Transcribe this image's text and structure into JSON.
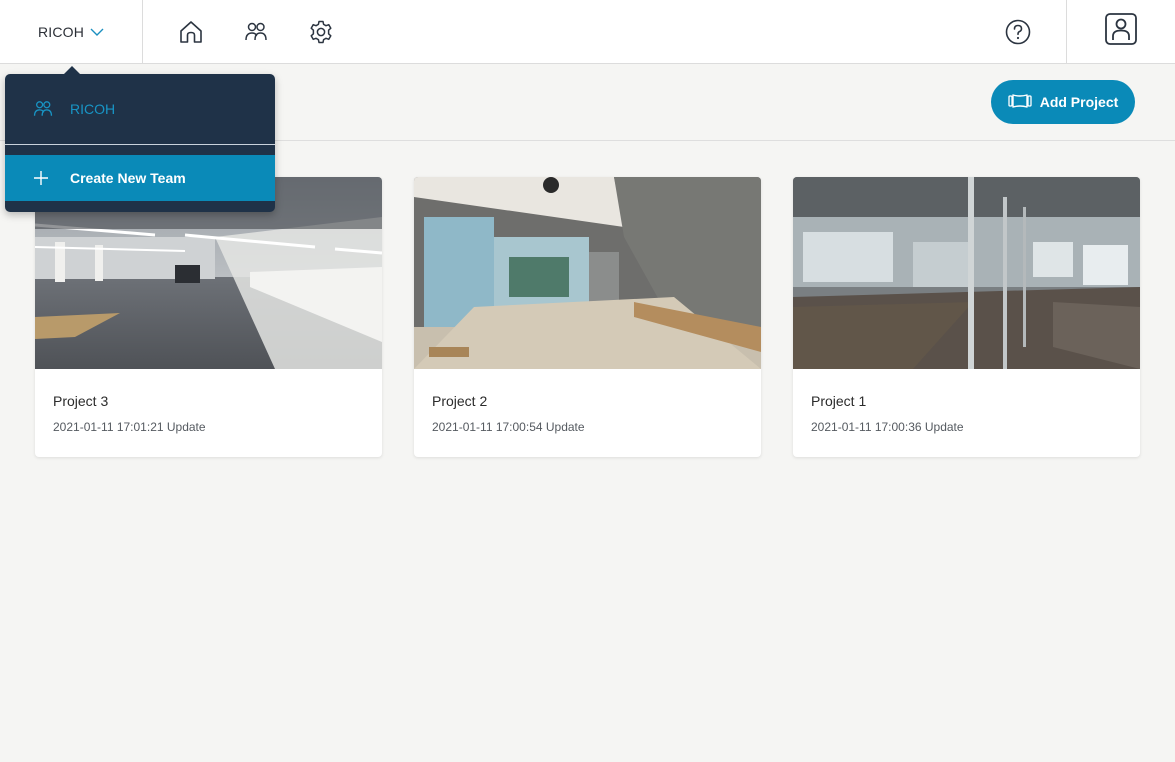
{
  "header": {
    "team_name": "RICOH",
    "icons": [
      "chevron-down-icon",
      "home-icon",
      "team-icon",
      "gear-icon",
      "help-icon",
      "user-icon"
    ]
  },
  "toolbar": {
    "add_project_label": "Add Project",
    "add_project_icon": "panorama-icon"
  },
  "dropdown": {
    "team_item_label": "RICOH",
    "create_label": "Create New Team"
  },
  "projects": [
    {
      "title": "Project 3",
      "updated": "2021-01-11 17:01:21 Update"
    },
    {
      "title": "Project 2",
      "updated": "2021-01-11 17:00:54 Update"
    },
    {
      "title": "Project 1",
      "updated": "2021-01-11 17:00:36 Update"
    }
  ],
  "colors": {
    "accent": "#0a8ab8",
    "dropdown_bg": "#1f3248",
    "page_bg": "#f5f5f3"
  }
}
